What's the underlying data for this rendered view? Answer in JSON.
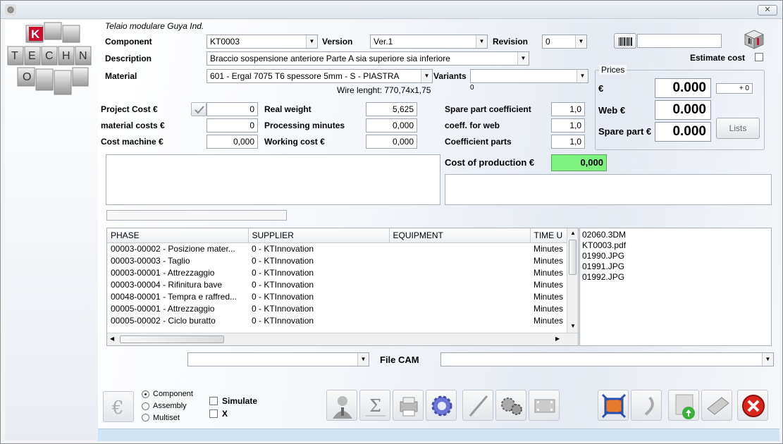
{
  "window": {
    "close_glyph": "✕"
  },
  "header": {
    "company_name": "Telaio modulare Guya Ind."
  },
  "logo": {
    "letters": [
      "K",
      "T",
      "E",
      "C",
      "H",
      "N",
      "O"
    ]
  },
  "component": {
    "label": "Component",
    "value": "KT0003"
  },
  "version": {
    "label": "Version",
    "value": "Ver.1"
  },
  "revision": {
    "label": "Revision",
    "value": "0"
  },
  "description": {
    "label": "Description",
    "value": "Braccio sospensione anteriore Parte A sia superiore sia inferiore"
  },
  "material": {
    "label": "Material",
    "value": "601 - Ergal 7075 T6 spessore 5mm - S - PIASTRA"
  },
  "variants": {
    "label": "Variants",
    "value": "",
    "count": "0"
  },
  "wire_length": "Wire lenght: 770,74x1,75",
  "estimate_cost": {
    "label": "Estimate cost",
    "checked": false
  },
  "prices": {
    "title": "Prices",
    "euro_label": "€",
    "euro_value": "0.000",
    "euro_delta": "+ 0",
    "web_label": "Web €",
    "web_value": "0.000",
    "spare_label": "Spare part €",
    "spare_value": "0.000",
    "lists_button": "Lists"
  },
  "costs": {
    "project_cost_label": "Project Cost €",
    "project_cost": "0",
    "material_costs_label": "material costs €",
    "material_costs": "0",
    "cost_machine_label": "Cost machine €",
    "cost_machine": "0,000",
    "real_weight_label": "Real weight",
    "real_weight": "5,625",
    "processing_minutes_label": "Processing minutes",
    "processing_minutes": "0,000",
    "working_cost_label": "Working cost €",
    "working_cost": "0,000",
    "spare_coeff_label": "Spare part coefficient",
    "spare_coeff": "1,0",
    "web_coeff_label": "coeff. for web",
    "web_coeff": "1,0",
    "parts_coeff_label": "Coefficient parts",
    "parts_coeff": "1,0",
    "production_label": "Cost of production €",
    "production_value": "0,000"
  },
  "phases": {
    "columns": [
      "PHASE",
      "SUPPLIER",
      "EQUIPMENT",
      "TIME U"
    ],
    "rows": [
      [
        "00003-00002 - Posizione mater...",
        "0 - KTInnovation",
        "",
        "Minutes"
      ],
      [
        "00003-00003 - Taglio",
        "0 - KTInnovation",
        "",
        "Minutes"
      ],
      [
        "00003-00001 - Attrezzaggio",
        "0 - KTInnovation",
        "",
        "Minutes"
      ],
      [
        "00003-00004 - Rifinitura bave",
        "0 - KTInnovation",
        "",
        "Minutes"
      ],
      [
        "00048-00001 - Tempra e raffred...",
        "0 - KTInnovation",
        "",
        "Minutes"
      ],
      [
        "00005-00001 - Attrezzaggio",
        "0 - KTInnovation",
        "",
        "Minutes"
      ],
      [
        "00005-00002 - Ciclo buratto",
        "0 - KTInnovation",
        "",
        "Minutes"
      ]
    ]
  },
  "files": [
    "02060.3DM",
    "KT0003.pdf",
    "01990.JPG",
    "01991.JPG",
    "01992.JPG"
  ],
  "file_cam": {
    "label": "File CAM",
    "left_value": "",
    "right_value": ""
  },
  "mode": {
    "options": [
      "Component",
      "Assembly",
      "Multiset"
    ],
    "selected": "Component"
  },
  "simulate": {
    "label": "Simulate",
    "checked": false
  },
  "x_option": {
    "label": "X",
    "checked": false
  },
  "icons": {
    "euro_btn": "euro-icon",
    "operator": "operator-icon",
    "sum": "sum-icon",
    "print": "print-icon",
    "settings": "gear-icon",
    "pen": "pen-icon",
    "gears": "gears-icon",
    "film": "film-icon",
    "fullscreen": "fullscreen-icon",
    "back": "back-icon",
    "upload": "upload-icon",
    "money": "money-icon",
    "exit": "exit-icon"
  },
  "colors": {
    "production_bg": "#7ef27e",
    "statusbar": "#cfe5f6",
    "exit_red": "#d9261c"
  }
}
